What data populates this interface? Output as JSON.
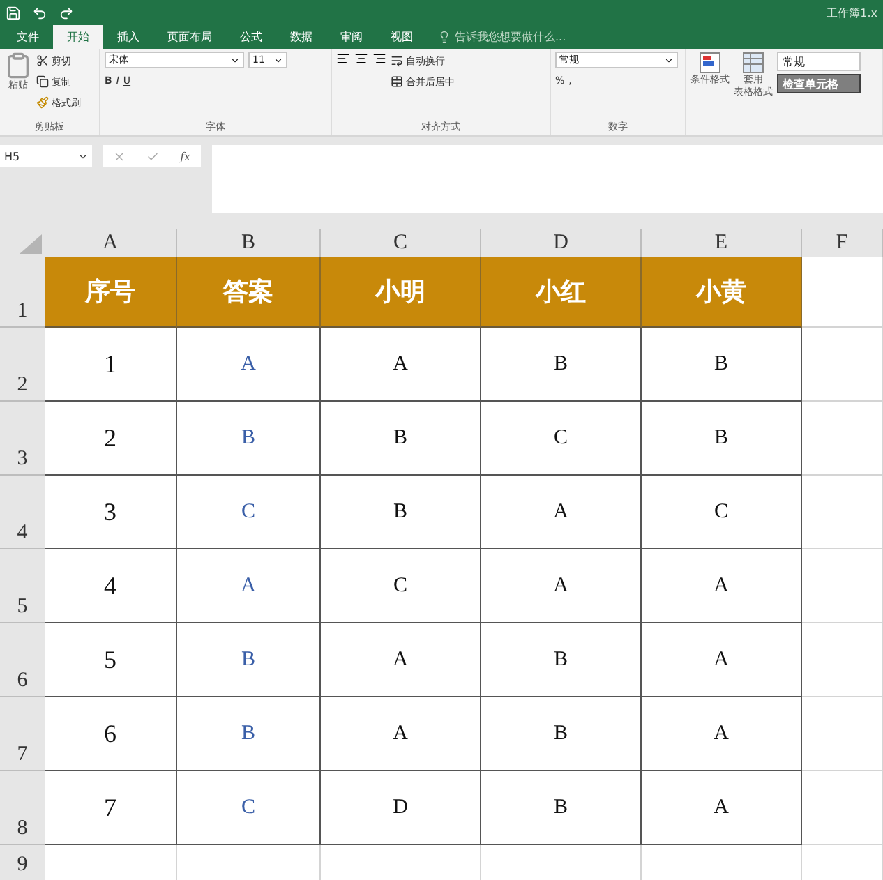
{
  "window": {
    "title": "工作簿1.x"
  },
  "tabs": [
    {
      "label": "文件",
      "selected": false
    },
    {
      "label": "开始",
      "selected": true
    },
    {
      "label": "插入",
      "selected": false
    },
    {
      "label": "页面布局",
      "selected": false
    },
    {
      "label": "公式",
      "selected": false
    },
    {
      "label": "数据",
      "selected": false
    },
    {
      "label": "审阅",
      "selected": false
    },
    {
      "label": "视图",
      "selected": false
    }
  ],
  "tell_me": {
    "placeholder": "告诉我您想要做什么..."
  },
  "ribbon": {
    "clipboard": {
      "paste": "粘贴",
      "cut": "剪切",
      "copy": "复制",
      "format_painter": "格式刷",
      "label": "剪贴板"
    },
    "font": {
      "name": "宋体",
      "size": "11",
      "bold": "B",
      "italic": "I",
      "underline": "U",
      "label": "字体"
    },
    "alignment": {
      "wrap": "自动换行",
      "merge": "合并后居中",
      "label": "对齐方式"
    },
    "number": {
      "format": "常规",
      "percent": "%",
      "comma": ",",
      "label": "数字"
    },
    "styles": {
      "conditional": "条件格式",
      "table_line1": "套用",
      "table_line2": "表格格式",
      "normal": "常规",
      "check_cell": "检查单元格"
    }
  },
  "formula_bar": {
    "name_box": "H5",
    "fx": "fx"
  },
  "sheet": {
    "columns": [
      "A",
      "B",
      "C",
      "D",
      "E",
      "F"
    ],
    "row_numbers": [
      "1",
      "2",
      "3",
      "4",
      "5",
      "6",
      "7",
      "8",
      "9"
    ],
    "header": [
      "序号",
      "答案",
      "小明",
      "小红",
      "小黄"
    ],
    "rows": [
      [
        "1",
        "A",
        "A",
        "B",
        "B"
      ],
      [
        "2",
        "B",
        "B",
        "C",
        "B"
      ],
      [
        "3",
        "C",
        "B",
        "A",
        "C"
      ],
      [
        "4",
        "A",
        "C",
        "A",
        "A"
      ],
      [
        "5",
        "B",
        "A",
        "B",
        "A"
      ],
      [
        "6",
        "B",
        "A",
        "B",
        "A"
      ],
      [
        "7",
        "C",
        "D",
        "B",
        "A"
      ]
    ]
  }
}
